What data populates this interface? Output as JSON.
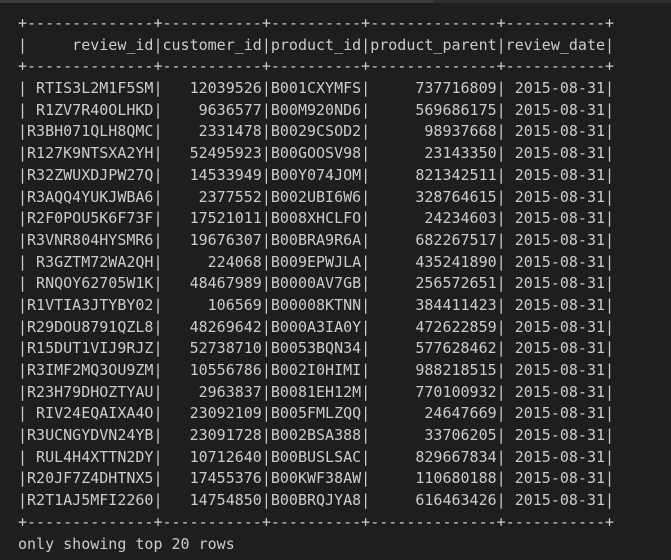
{
  "table": {
    "border": "+--------------+-----------+----------+--------------+-----------+",
    "columns": [
      {
        "name": "review_id",
        "width": 14,
        "align": "right"
      },
      {
        "name": "customer_id",
        "width": 11,
        "align": "right"
      },
      {
        "name": "product_id",
        "width": 10,
        "align": "left"
      },
      {
        "name": "product_parent",
        "width": 14,
        "align": "right"
      },
      {
        "name": "review_date",
        "width": 11,
        "align": "right"
      }
    ],
    "header": "|     review_id|customer_id|product_id|product_parent|review_date|",
    "rows": [
      "| RTIS3L2M1F5SM|   12039526|B001CXYMFS|     737716809| 2015-08-31|",
      "| R1ZV7R40OLHKD|    9636577|B00M920ND6|     569686175| 2015-08-31|",
      "|R3BH071QLH8QMC|    2331478|B0029CSOD2|      98937668| 2015-08-31|",
      "|R127K9NTSXA2YH|   52495923|B00GOOSV98|      23143350| 2015-08-31|",
      "|R32ZWUXDJPW27Q|   14533949|B00Y074JOM|     821342511| 2015-08-31|",
      "|R3AQQ4YUKJWBA6|    2377552|B002UBI6W6|     328764615| 2015-08-31|",
      "|R2F0POU5K6F73F|   17521011|B008XHCLFO|      24234603| 2015-08-31|",
      "|R3VNR804HYSMR6|   19676307|B00BRA9R6A|     682267517| 2015-08-31|",
      "| R3GZTM72WA2QH|     224068|B009EPWJLA|     435241890| 2015-08-31|",
      "| RNQOY62705W1K|   48467989|B0000AV7GB|     256572651| 2015-08-31|",
      "|R1VTIA3JTYBY02|     106569|B00008KTNN|     384411423| 2015-08-31|",
      "|R29DOU8791QZL8|   48269642|B000A3IA0Y|     472622859| 2015-08-31|",
      "|R15DUT1VIJ9RJZ|   52738710|B0053BQN34|     577628462| 2015-08-31|",
      "|R3IMF2MQ3OU9ZM|   10556786|B002I0HIMI|     988218515| 2015-08-31|",
      "|R23H79DHOZTYAU|    2963837|B0081EH12M|     770100932| 2015-08-31|",
      "| RIV24EQAIXA4O|   23092109|B005FMLZQQ|      24647669| 2015-08-31|",
      "|R3UCNGYDVN24YB|   23091728|B002BSA388|      33706205| 2015-08-31|",
      "| RUL4H4XTTN2DY|   10712640|B00BUSLSAC|     829667834| 2015-08-31|",
      "|R20JF7Z4DHTNX5|   17455376|B00KWF38AW|     110680188| 2015-08-31|",
      "|R2T1AJ5MFI2260|   14754850|B00BRQJYA8|     616463426| 2015-08-31|"
    ]
  },
  "footer": "only showing top 20 rows",
  "colors": {
    "background": "#1e1e1e",
    "text": "#cccccc"
  }
}
